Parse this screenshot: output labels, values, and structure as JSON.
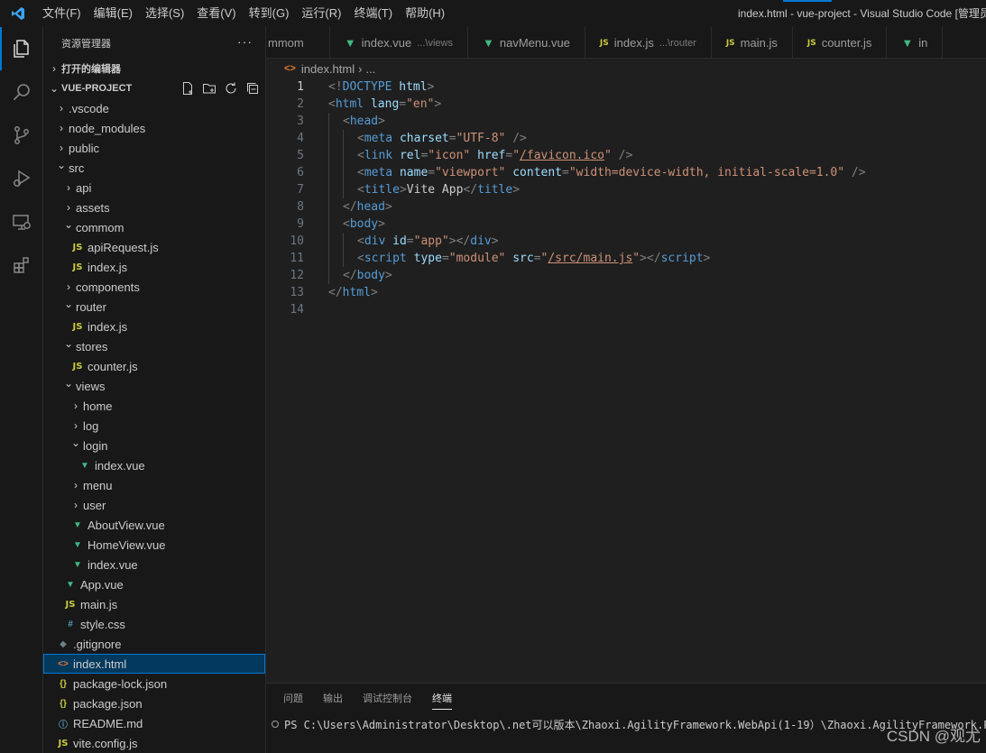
{
  "titlebar": {
    "menu": [
      "文件(F)",
      "编辑(E)",
      "选择(S)",
      "查看(V)",
      "转到(G)",
      "运行(R)",
      "终端(T)",
      "帮助(H)"
    ],
    "window_title": "index.html - vue-project - Visual Studio Code [管理员]"
  },
  "activitybar": {
    "icons": [
      "explorer-icon",
      "search-icon",
      "source-control-icon",
      "run-debug-icon",
      "remote-explorer-icon",
      "extensions-icon"
    ]
  },
  "sidebar": {
    "title": "资源管理器",
    "more": "···",
    "open_editors": "打开的编辑器",
    "project": "VUE-PROJECT",
    "tree": [
      {
        "label": ".vscode",
        "type": "folder",
        "expanded": false,
        "depth": 0
      },
      {
        "label": "node_modules",
        "type": "folder",
        "expanded": false,
        "depth": 0
      },
      {
        "label": "public",
        "type": "folder",
        "expanded": false,
        "depth": 0
      },
      {
        "label": "src",
        "type": "folder",
        "expanded": true,
        "depth": 0
      },
      {
        "label": "api",
        "type": "folder",
        "expanded": false,
        "depth": 1
      },
      {
        "label": "assets",
        "type": "folder",
        "expanded": false,
        "depth": 1
      },
      {
        "label": "commom",
        "type": "folder",
        "expanded": true,
        "depth": 1
      },
      {
        "label": "apiRequest.js",
        "type": "js",
        "depth": 2
      },
      {
        "label": "index.js",
        "type": "js",
        "depth": 2
      },
      {
        "label": "components",
        "type": "folder",
        "expanded": false,
        "depth": 1
      },
      {
        "label": "router",
        "type": "folder",
        "expanded": true,
        "depth": 1
      },
      {
        "label": "index.js",
        "type": "js",
        "depth": 2
      },
      {
        "label": "stores",
        "type": "folder",
        "expanded": true,
        "depth": 1
      },
      {
        "label": "counter.js",
        "type": "js",
        "depth": 2
      },
      {
        "label": "views",
        "type": "folder",
        "expanded": true,
        "depth": 1
      },
      {
        "label": "home",
        "type": "folder",
        "expanded": false,
        "depth": 2
      },
      {
        "label": "log",
        "type": "folder",
        "expanded": false,
        "depth": 2
      },
      {
        "label": "login",
        "type": "folder",
        "expanded": true,
        "depth": 2
      },
      {
        "label": "index.vue",
        "type": "vue",
        "depth": 3
      },
      {
        "label": "menu",
        "type": "folder",
        "expanded": false,
        "depth": 2
      },
      {
        "label": "user",
        "type": "folder",
        "expanded": false,
        "depth": 2
      },
      {
        "label": "AboutView.vue",
        "type": "vue",
        "depth": 2
      },
      {
        "label": "HomeView.vue",
        "type": "vue",
        "depth": 2
      },
      {
        "label": "index.vue",
        "type": "vue",
        "depth": 2
      },
      {
        "label": "App.vue",
        "type": "vue",
        "depth": 1
      },
      {
        "label": "main.js",
        "type": "js",
        "depth": 1
      },
      {
        "label": "style.css",
        "type": "css",
        "depth": 1
      },
      {
        "label": ".gitignore",
        "type": "git",
        "depth": 0
      },
      {
        "label": "index.html",
        "type": "html",
        "depth": 0,
        "selected": true
      },
      {
        "label": "package-lock.json",
        "type": "json",
        "depth": 0
      },
      {
        "label": "package.json",
        "type": "json",
        "depth": 0
      },
      {
        "label": "README.md",
        "type": "info",
        "depth": 0
      },
      {
        "label": "vite.config.js",
        "type": "js",
        "depth": 0
      }
    ]
  },
  "tabs": [
    {
      "label": "mmom",
      "desc": "",
      "icon": ""
    },
    {
      "label": "index.vue",
      "desc": "...\\views",
      "icon": "vue"
    },
    {
      "label": "navMenu.vue",
      "desc": "",
      "icon": "vue"
    },
    {
      "label": "index.js",
      "desc": "...\\router",
      "icon": "js"
    },
    {
      "label": "main.js",
      "desc": "",
      "icon": "js"
    },
    {
      "label": "counter.js",
      "desc": "",
      "icon": "js"
    },
    {
      "label": "in",
      "desc": "",
      "icon": "vue"
    }
  ],
  "breadcrumb": {
    "file": "index.html",
    "sep": "›",
    "rest": "..."
  },
  "editor": {
    "lines": [
      {
        "n": "1",
        "indent": 0,
        "tokens": [
          [
            "p",
            "<!"
          ],
          [
            "t",
            "DOCTYPE"
          ],
          [
            "p",
            " "
          ],
          [
            "a",
            "html"
          ],
          [
            "p",
            ">"
          ]
        ]
      },
      {
        "n": "2",
        "indent": 0,
        "tokens": [
          [
            "p",
            "<"
          ],
          [
            "t",
            "html"
          ],
          [
            "p",
            " "
          ],
          [
            "a",
            "lang"
          ],
          [
            "p",
            "="
          ],
          [
            "s",
            "\"en\""
          ],
          [
            "p",
            ">"
          ]
        ]
      },
      {
        "n": "3",
        "indent": 1,
        "tokens": [
          [
            "p",
            "<"
          ],
          [
            "t",
            "head"
          ],
          [
            "p",
            ">"
          ]
        ]
      },
      {
        "n": "4",
        "indent": 2,
        "tokens": [
          [
            "p",
            "<"
          ],
          [
            "t",
            "meta"
          ],
          [
            "p",
            " "
          ],
          [
            "a",
            "charset"
          ],
          [
            "p",
            "="
          ],
          [
            "s",
            "\"UTF-8\""
          ],
          [
            "p",
            " />"
          ]
        ]
      },
      {
        "n": "5",
        "indent": 2,
        "tokens": [
          [
            "p",
            "<"
          ],
          [
            "t",
            "link"
          ],
          [
            "p",
            " "
          ],
          [
            "a",
            "rel"
          ],
          [
            "p",
            "="
          ],
          [
            "s",
            "\"icon\""
          ],
          [
            "p",
            " "
          ],
          [
            "a",
            "href"
          ],
          [
            "p",
            "="
          ],
          [
            "s",
            "\""
          ],
          [
            "sl",
            "/favicon.ico"
          ],
          [
            "s",
            "\""
          ],
          [
            "p",
            " />"
          ]
        ]
      },
      {
        "n": "6",
        "indent": 2,
        "tokens": [
          [
            "p",
            "<"
          ],
          [
            "t",
            "meta"
          ],
          [
            "p",
            " "
          ],
          [
            "a",
            "name"
          ],
          [
            "p",
            "="
          ],
          [
            "s",
            "\"viewport\""
          ],
          [
            "p",
            " "
          ],
          [
            "a",
            "content"
          ],
          [
            "p",
            "="
          ],
          [
            "s",
            "\"width=device-width, initial-scale=1.0\""
          ],
          [
            "p",
            " />"
          ]
        ]
      },
      {
        "n": "7",
        "indent": 2,
        "tokens": [
          [
            "p",
            "<"
          ],
          [
            "t",
            "title"
          ],
          [
            "p",
            ">"
          ],
          [
            "x",
            "Vite App"
          ],
          [
            "p",
            "</"
          ],
          [
            "t",
            "title"
          ],
          [
            "p",
            ">"
          ]
        ]
      },
      {
        "n": "8",
        "indent": 1,
        "tokens": [
          [
            "p",
            "</"
          ],
          [
            "t",
            "head"
          ],
          [
            "p",
            ">"
          ]
        ]
      },
      {
        "n": "9",
        "indent": 1,
        "tokens": [
          [
            "p",
            "<"
          ],
          [
            "t",
            "body"
          ],
          [
            "p",
            ">"
          ]
        ]
      },
      {
        "n": "10",
        "indent": 2,
        "tokens": [
          [
            "p",
            "<"
          ],
          [
            "t",
            "div"
          ],
          [
            "p",
            " "
          ],
          [
            "a",
            "id"
          ],
          [
            "p",
            "="
          ],
          [
            "s",
            "\"app\""
          ],
          [
            "p",
            "></"
          ],
          [
            "t",
            "div"
          ],
          [
            "p",
            ">"
          ]
        ]
      },
      {
        "n": "11",
        "indent": 2,
        "tokens": [
          [
            "p",
            "<"
          ],
          [
            "t",
            "script"
          ],
          [
            "p",
            " "
          ],
          [
            "a",
            "type"
          ],
          [
            "p",
            "="
          ],
          [
            "s",
            "\"module\""
          ],
          [
            "p",
            " "
          ],
          [
            "a",
            "src"
          ],
          [
            "p",
            "="
          ],
          [
            "s",
            "\""
          ],
          [
            "sl",
            "/src/main.js"
          ],
          [
            "s",
            "\""
          ],
          [
            "p",
            "></"
          ],
          [
            "t",
            "script"
          ],
          [
            "p",
            ">"
          ]
        ]
      },
      {
        "n": "12",
        "indent": 1,
        "tokens": [
          [
            "p",
            "</"
          ],
          [
            "t",
            "body"
          ],
          [
            "p",
            ">"
          ]
        ]
      },
      {
        "n": "13",
        "indent": 0,
        "tokens": [
          [
            "p",
            "</"
          ],
          [
            "t",
            "html"
          ],
          [
            "p",
            ">"
          ]
        ]
      },
      {
        "n": "14",
        "indent": 0,
        "tokens": []
      }
    ],
    "current_line": "1"
  },
  "panel": {
    "tabs": [
      "问题",
      "输出",
      "调试控制台",
      "终端"
    ],
    "active_tab": "终端",
    "terminal_text": "PS C:\\Users\\Administrator\\Desktop\\.net可以版本\\Zhaoxi.AgilityFramework.WebApi(1-19）\\Zhaoxi.AgilityFramework.Po"
  },
  "watermark": "CSDN @观尤",
  "colors": {
    "accent": "#0078d4",
    "vue": "#41b883",
    "js": "#cbcb41",
    "html": "#e37933",
    "tag": "#569cd6",
    "attr": "#9cdcfe",
    "string": "#ce9178"
  }
}
